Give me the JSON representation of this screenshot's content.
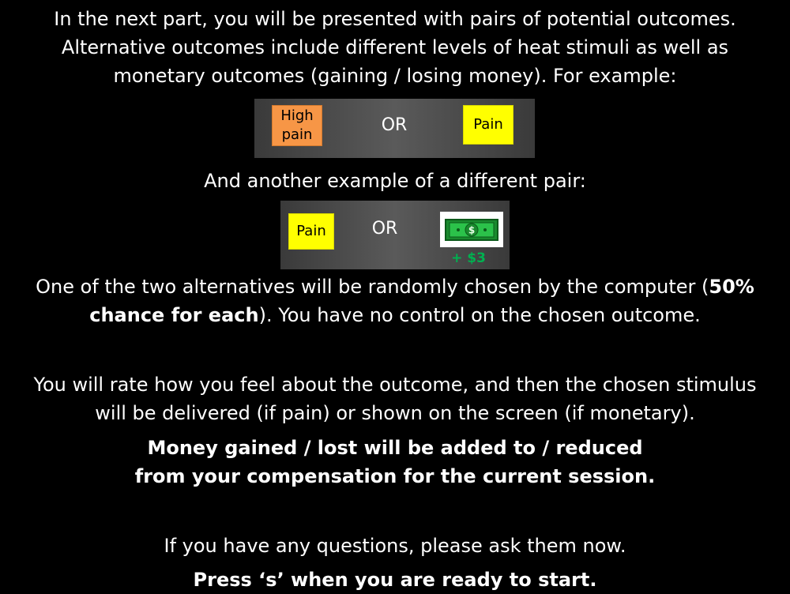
{
  "intro": {
    "line1": "In the next part, you will be presented with pairs of potential outcomes.",
    "line2": "Alternative outcomes include different levels of heat stimuli as well as",
    "line3": "monetary outcomes (gaining / losing money). For example:"
  },
  "example1": {
    "left_label": "High\npain",
    "separator": "OR",
    "right_label": "Pain"
  },
  "another_example": "And another example of a different pair:",
  "example2": {
    "left_label": "Pain",
    "separator": "OR",
    "money_icon": "dollar-bill-icon",
    "money_label": "+ $3"
  },
  "chance": {
    "line1_a": "One of the two alternatives will be randomly chosen by the computer (",
    "line1_b": "50%",
    "line2_a": "chance for each",
    "line2_b": "). You have no control on the chosen outcome."
  },
  "rating": {
    "line1": "You will rate how you feel about the outcome, and then the chosen stimulus",
    "line2": "will be delivered (if pain) or shown on the screen (if monetary)."
  },
  "compensation": {
    "line1": "Money gained / lost will be added to / reduced",
    "line2": "from your compensation for the current session."
  },
  "questions": "If you have any questions, please ask them now.",
  "start_prompt": "Press ‘s’ when you are ready to start.",
  "colors": {
    "background": "#000000",
    "high_pain": "#f79646",
    "pain": "#ffff00",
    "money_green": "#00b050"
  }
}
